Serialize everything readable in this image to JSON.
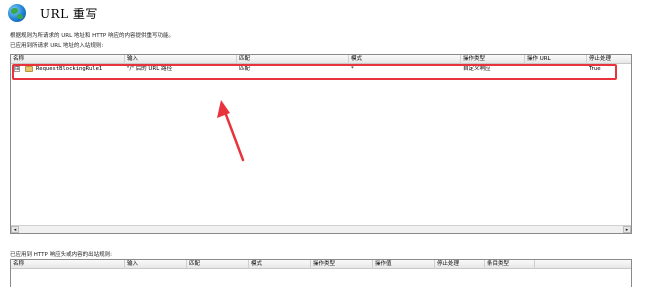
{
  "header": {
    "title": "URL 重写",
    "icon": "globe-icon"
  },
  "description": "根据规则为所请求的 URL 地址和 HTTP 响应的内容提供重写功能。",
  "inbound": {
    "section_label": "已应用到所请求 URL 地址的入站规则:",
    "columns": [
      "名称",
      "输入",
      "匹配",
      "模式",
      "操作类型",
      "操作 URL",
      "停止处理"
    ],
    "rows": [
      {
        "expander": "⊞",
        "name": "RequestBlockingRule1",
        "input": "\"/\" 后的 URL 路径",
        "match": "匹配",
        "pattern": "*",
        "action_type": "自定义响应",
        "action_url": "",
        "stop": "True"
      }
    ],
    "scroll_left": "◂",
    "scroll_right": "▸"
  },
  "outbound": {
    "section_label": "已应用到 HTTP 响应头或内容的出站规则:",
    "columns": [
      "名称",
      "输入",
      "匹配",
      "模式",
      "操作类型",
      "操作值",
      "停止处理",
      "条目类型"
    ]
  },
  "colors": {
    "highlight": "#e8323c",
    "arrow": "#e8323c"
  }
}
